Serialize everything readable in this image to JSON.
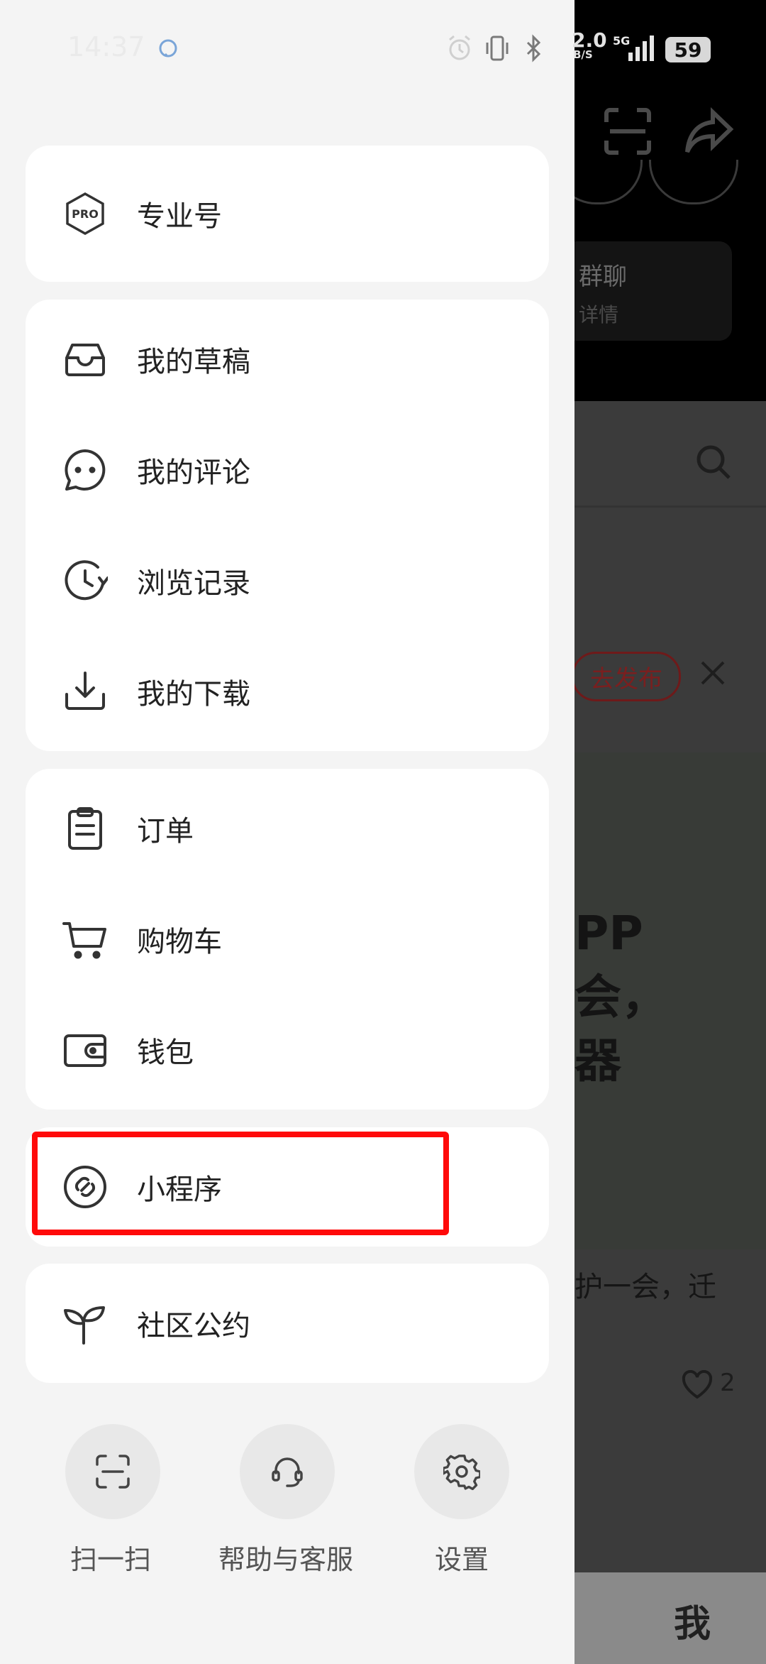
{
  "status_bar": {
    "time": "14:37",
    "network_speed": "2.0",
    "network_speed_unit": "B/S",
    "signal": "5G",
    "battery": "59"
  },
  "drawer": {
    "sections": [
      {
        "items": [
          {
            "label": "专业号",
            "icon": "pro-badge-icon"
          }
        ]
      },
      {
        "items": [
          {
            "label": "我的草稿",
            "icon": "inbox-tray-icon"
          },
          {
            "label": "我的评论",
            "icon": "chat-bubble-icon"
          },
          {
            "label": "浏览记录",
            "icon": "history-clock-icon"
          },
          {
            "label": "我的下载",
            "icon": "download-icon"
          }
        ]
      },
      {
        "items": [
          {
            "label": "订单",
            "icon": "clipboard-icon"
          },
          {
            "label": "购物车",
            "icon": "shopping-cart-icon"
          },
          {
            "label": "钱包",
            "icon": "wallet-icon"
          }
        ]
      },
      {
        "items": [
          {
            "label": "小程序",
            "icon": "mini-program-link-icon"
          }
        ]
      },
      {
        "items": [
          {
            "label": "社区公约",
            "icon": "sprout-icon"
          }
        ]
      }
    ],
    "bottom_actions": [
      {
        "label": "扫一扫",
        "icon": "scan-icon"
      },
      {
        "label": "帮助与客服",
        "icon": "headset-icon"
      },
      {
        "label": "设置",
        "icon": "gear-icon"
      }
    ],
    "highlight_color": "#ff0a0a"
  },
  "background_page": {
    "group_chat_title": "群聊",
    "group_chat_sub": "详情",
    "publish_button": "去发布",
    "headline_lines": [
      "PP",
      "会，",
      "器"
    ],
    "snippet": "护一会，迁",
    "like_count": "2",
    "me_tab": "我"
  }
}
